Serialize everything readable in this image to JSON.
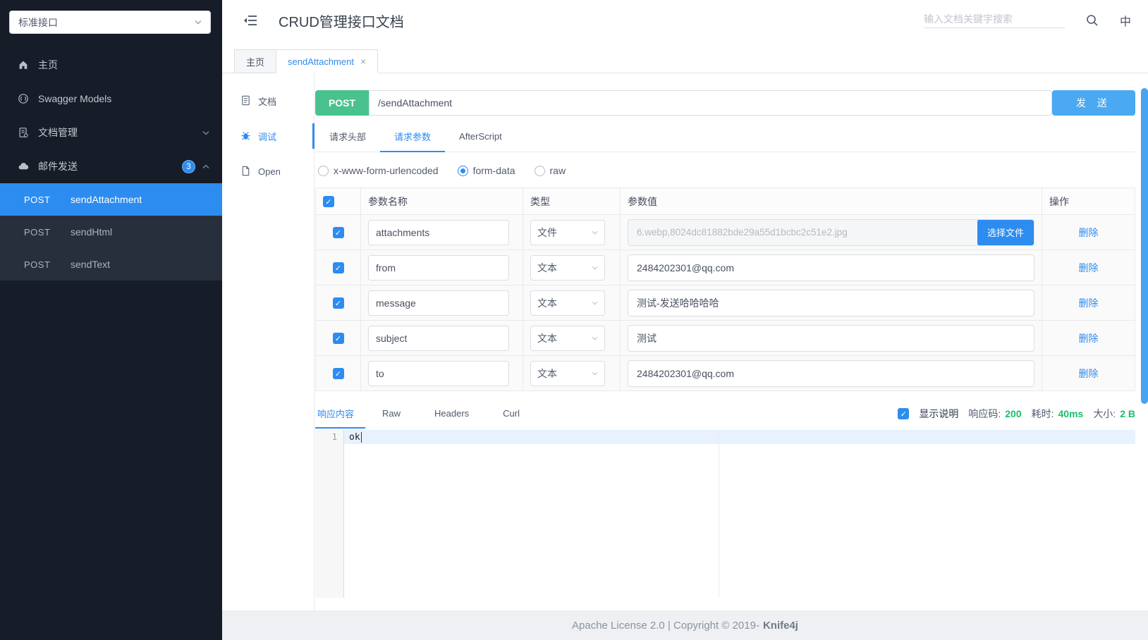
{
  "sidebar": {
    "group_select_value": "标准接口",
    "items": [
      {
        "label": "主页"
      },
      {
        "label": "Swagger Models"
      },
      {
        "label": "文档管理"
      },
      {
        "label": "邮件发送",
        "badge": "3"
      }
    ],
    "operations": [
      {
        "method": "POST",
        "name": "sendAttachment"
      },
      {
        "method": "POST",
        "name": "sendHtml"
      },
      {
        "method": "POST",
        "name": "sendText"
      }
    ]
  },
  "header": {
    "title": "CRUD管理接口文档",
    "search_placeholder": "输入文档关键字搜索",
    "language": "中"
  },
  "tabbar": {
    "tabs": [
      {
        "label": "主页"
      },
      {
        "label": "sendAttachment",
        "close": "×"
      }
    ]
  },
  "doc_nav": {
    "items": [
      {
        "label": "文档"
      },
      {
        "label": "调试"
      },
      {
        "label": "Open"
      }
    ]
  },
  "debug": {
    "method": "POST",
    "path": "/sendAttachment",
    "send_label": "发 送",
    "request_tabs": [
      {
        "label": "请求头部"
      },
      {
        "label": "请求参数"
      },
      {
        "label": "AfterScript"
      }
    ],
    "body_types": [
      {
        "label": "x-www-form-urlencoded"
      },
      {
        "label": "form-data"
      },
      {
        "label": "raw"
      }
    ],
    "table": {
      "headers": [
        "参数名称",
        "类型",
        "参数值",
        "操作"
      ],
      "choose_file_label": "选择文件",
      "delete_label": "删除",
      "rows": [
        {
          "name": "attachments",
          "type": "文件",
          "value": "6.webp,8024dc81882bde29a55d1bcbc2c51e2.jpg"
        },
        {
          "name": "from",
          "type": "文本",
          "value": "2484202301@qq.com"
        },
        {
          "name": "message",
          "type": "文本",
          "value": "测试-发送哈哈哈哈"
        },
        {
          "name": "subject",
          "type": "文本",
          "value": "测试"
        },
        {
          "name": "to",
          "type": "文本",
          "value": "2484202301@qq.com"
        }
      ]
    }
  },
  "response": {
    "tabs": [
      {
        "label": "响应内容"
      },
      {
        "label": "Raw"
      },
      {
        "label": "Headers"
      },
      {
        "label": "Curl"
      }
    ],
    "show_desc_label": "显示说明",
    "status_label": "响应码:",
    "status_value": "200",
    "time_label": "耗时:",
    "time_value": "40ms",
    "size_label": "大小:",
    "size_value": "2 B",
    "editor": {
      "line_number": "1",
      "content": "ok"
    }
  },
  "footer": {
    "text": "Apache License 2.0 | Copyright © 2019-",
    "brand": "Knife4j"
  },
  "colors": {
    "primary_blue": "#2d8cf0",
    "send_button_blue": "#4ba9f1",
    "method_green": "#4ac28e",
    "success_green": "#19be6b",
    "sidebar_bg": "#161c28",
    "submenu_bg": "#272f3d"
  }
}
